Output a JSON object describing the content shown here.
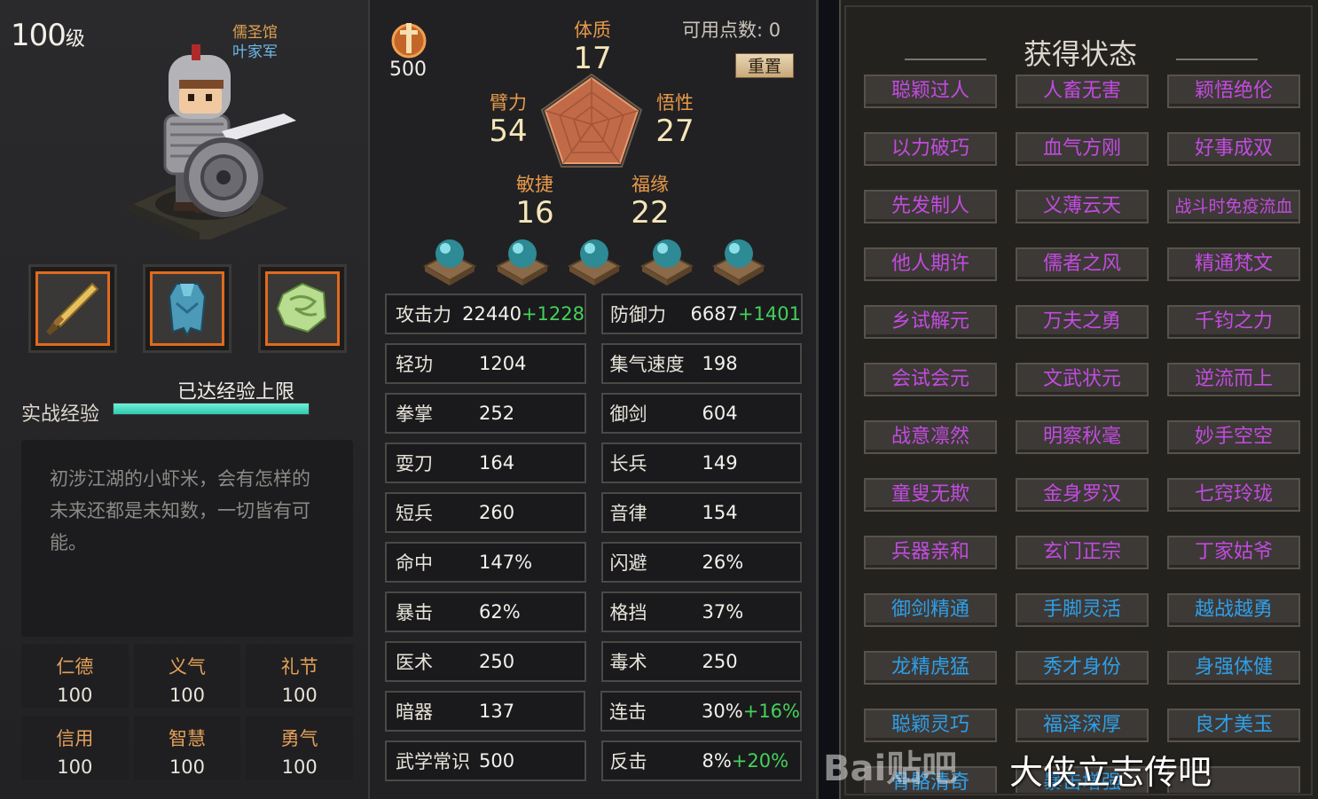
{
  "character": {
    "level": "100",
    "level_unit": "级",
    "school": "儒圣馆",
    "army": "叶家军",
    "exp_label": "实战经验",
    "exp_cap_text": "已达经验上限",
    "exp_progress": 1.0,
    "description": "初涉江湖的小虾米，会有怎样的未来还都是未知数，一切皆有可能。",
    "equipment": [
      {
        "slot": "weapon",
        "icon": "sword-icon"
      },
      {
        "slot": "armor",
        "icon": "armor-icon"
      },
      {
        "slot": "accessory",
        "icon": "jade-icon"
      }
    ],
    "virtues": [
      {
        "name": "仁德",
        "value": "100"
      },
      {
        "name": "义气",
        "value": "100"
      },
      {
        "name": "礼节",
        "value": "100"
      },
      {
        "name": "信用",
        "value": "100"
      },
      {
        "name": "智慧",
        "value": "100"
      },
      {
        "name": "勇气",
        "value": "100"
      }
    ]
  },
  "attributes": {
    "power_value": "500",
    "points_label": "可用点数:",
    "points_value": "0",
    "reset_label": "重置",
    "constitution": {
      "name": "体质",
      "value": "17"
    },
    "strength": {
      "name": "臂力",
      "value": "54"
    },
    "wisdom": {
      "name": "悟性",
      "value": "27"
    },
    "agility": {
      "name": "敏捷",
      "value": "16"
    },
    "luck": {
      "name": "福缘",
      "value": "22"
    }
  },
  "gems": [
    "gem-icon",
    "gem-icon",
    "gem-icon",
    "gem-icon",
    "gem-icon"
  ],
  "stats": [
    [
      {
        "name": "攻击力",
        "value": "22440",
        "bonus": "+1228"
      },
      {
        "name": "防御力",
        "value": "6687",
        "bonus": "+1401"
      }
    ],
    [
      {
        "name": "轻功",
        "value": "1204",
        "bonus": ""
      },
      {
        "name": "集气速度",
        "value": "198",
        "bonus": ""
      }
    ],
    [
      {
        "name": "拳掌",
        "value": "252",
        "bonus": ""
      },
      {
        "name": "御剑",
        "value": "604",
        "bonus": ""
      }
    ],
    [
      {
        "name": "耍刀",
        "value": "164",
        "bonus": ""
      },
      {
        "name": "长兵",
        "value": "149",
        "bonus": ""
      }
    ],
    [
      {
        "name": "短兵",
        "value": "260",
        "bonus": ""
      },
      {
        "name": "音律",
        "value": "154",
        "bonus": ""
      }
    ],
    [
      {
        "name": "命中",
        "value": "147%",
        "bonus": ""
      },
      {
        "name": "闪避",
        "value": "26%",
        "bonus": ""
      }
    ],
    [
      {
        "name": "暴击",
        "value": "62%",
        "bonus": ""
      },
      {
        "name": "格挡",
        "value": "37%",
        "bonus": ""
      }
    ],
    [
      {
        "name": "医术",
        "value": "250",
        "bonus": ""
      },
      {
        "name": "毒术",
        "value": "250",
        "bonus": ""
      }
    ],
    [
      {
        "name": "暗器",
        "value": "137",
        "bonus": ""
      },
      {
        "name": "连击",
        "value": "30%",
        "bonus": "+16%"
      }
    ],
    [
      {
        "name": "武学常识",
        "value": "500",
        "bonus": ""
      },
      {
        "name": "反击",
        "value": "8%",
        "bonus": "+20%"
      }
    ]
  ],
  "status": {
    "title": "获得状态",
    "items": [
      {
        "label": "聪颖过人",
        "color": "#c24be0"
      },
      {
        "label": "人畜无害",
        "color": "#c24be0"
      },
      {
        "label": "颖悟绝伦",
        "color": "#c24be0"
      },
      {
        "label": "以力破巧",
        "color": "#c24be0"
      },
      {
        "label": "血气方刚",
        "color": "#c24be0"
      },
      {
        "label": "好事成双",
        "color": "#c24be0"
      },
      {
        "label": "先发制人",
        "color": "#c24be0"
      },
      {
        "label": "义薄云天",
        "color": "#c24be0"
      },
      {
        "label": "战斗时免疫流血",
        "color": "#c24be0"
      },
      {
        "label": "他人期许",
        "color": "#c24be0"
      },
      {
        "label": "儒者之风",
        "color": "#c24be0"
      },
      {
        "label": "精通梵文",
        "color": "#c24be0"
      },
      {
        "label": "乡试解元",
        "color": "#c24be0"
      },
      {
        "label": "万夫之勇",
        "color": "#c24be0"
      },
      {
        "label": "千钧之力",
        "color": "#c24be0"
      },
      {
        "label": "会试会元",
        "color": "#c24be0"
      },
      {
        "label": "文武状元",
        "color": "#c24be0"
      },
      {
        "label": "逆流而上",
        "color": "#c24be0"
      },
      {
        "label": "战意凛然",
        "color": "#c24be0"
      },
      {
        "label": "明察秋毫",
        "color": "#c24be0"
      },
      {
        "label": "妙手空空",
        "color": "#c24be0"
      },
      {
        "label": "童叟无欺",
        "color": "#c24be0"
      },
      {
        "label": "金身罗汉",
        "color": "#c24be0"
      },
      {
        "label": "七窍玲珑",
        "color": "#c24be0"
      },
      {
        "label": "兵器亲和",
        "color": "#c24be0"
      },
      {
        "label": "玄门正宗",
        "color": "#c24be0"
      },
      {
        "label": "丁家姑爷",
        "color": "#c24be0"
      },
      {
        "label": "御剑精通",
        "color": "#2e9fe8"
      },
      {
        "label": "手脚灵活",
        "color": "#2e9fe8"
      },
      {
        "label": "越战越勇",
        "color": "#2e9fe8"
      },
      {
        "label": "龙精虎猛",
        "color": "#2e9fe8"
      },
      {
        "label": "秀才身份",
        "color": "#2e9fe8"
      },
      {
        "label": "身强体健",
        "color": "#2e9fe8"
      },
      {
        "label": "聪颖灵巧",
        "color": "#2e9fe8"
      },
      {
        "label": "福泽深厚",
        "color": "#2e9fe8"
      },
      {
        "label": "良才美玉",
        "color": "#2e9fe8"
      },
      {
        "label": "骨骼清奇",
        "color": "#2e9fe8"
      },
      {
        "label": "暴击增强",
        "color": "#2e9fe8"
      },
      {
        "label": "",
        "color": "#2e9fe8"
      }
    ]
  },
  "watermark": {
    "logo": "Bai贴吧",
    "text": "大侠立志传吧"
  }
}
